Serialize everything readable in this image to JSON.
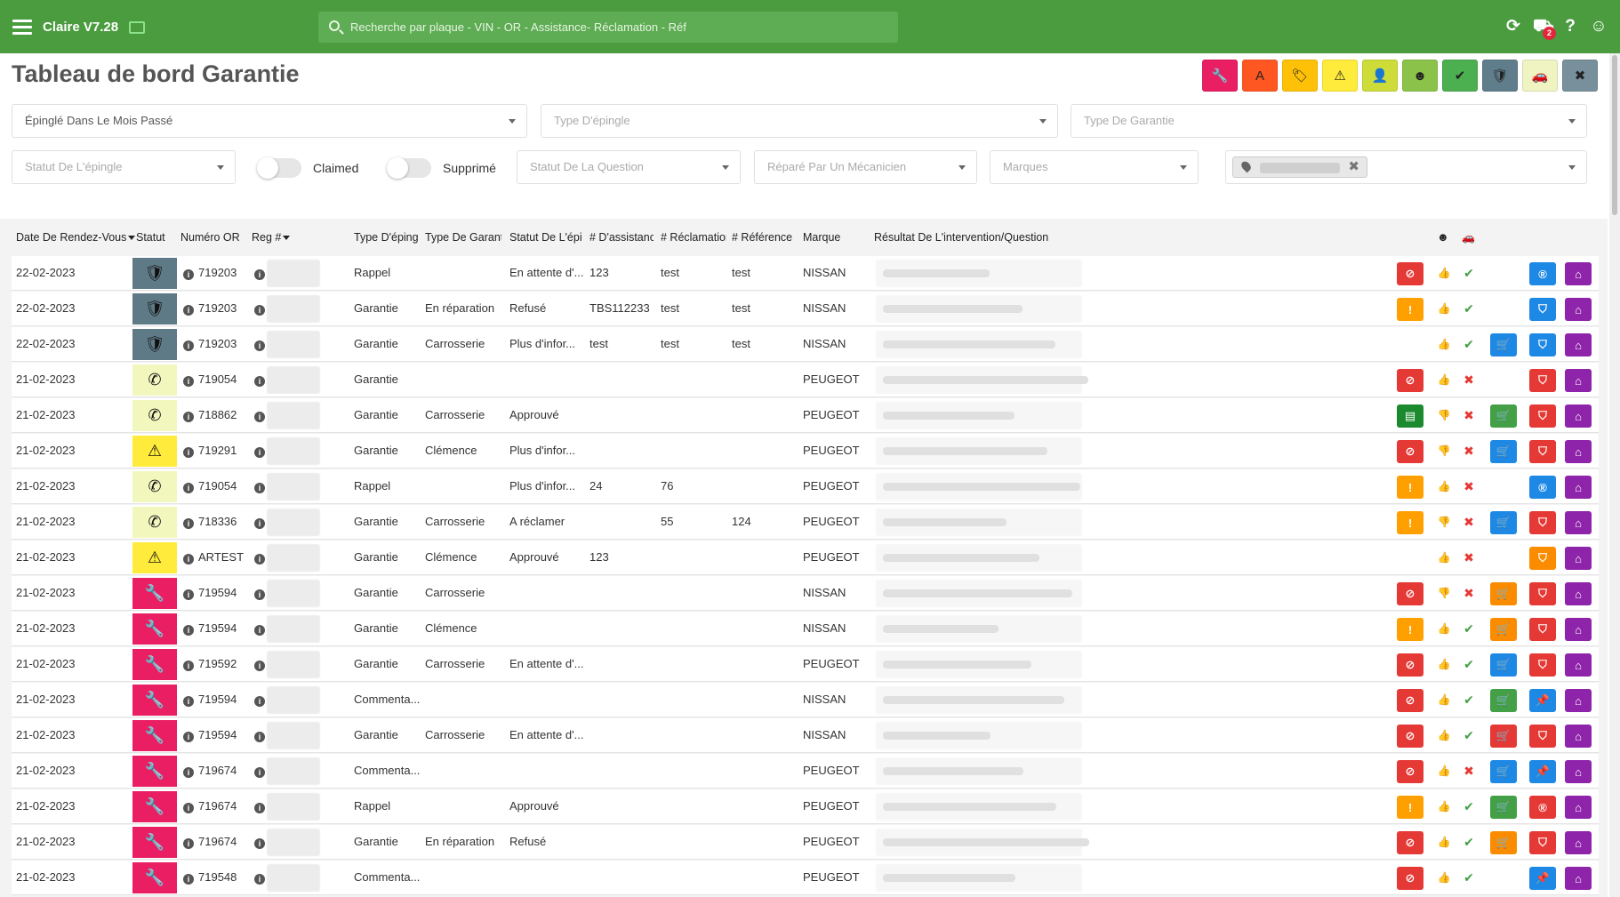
{
  "app": {
    "title": "Claire V7.28"
  },
  "search": {
    "placeholder": "Recherche par plaque - VIN - OR - Assistance- Réclamation - Réf"
  },
  "notifications": {
    "count": "2"
  },
  "page": {
    "title": "Tableau de bord Garantie"
  },
  "filter_buttons": [
    {
      "name": "wrench",
      "color": "#e91e63",
      "glyph": "🔧"
    },
    {
      "name": "letter-a",
      "color": "#ff5722",
      "glyph": "A"
    },
    {
      "name": "tag",
      "color": "#ffc107",
      "glyph": "🏷"
    },
    {
      "name": "warning",
      "color": "#ffeb3b",
      "glyph": "⚠"
    },
    {
      "name": "user-check",
      "color": "#cddc39",
      "glyph": "👤"
    },
    {
      "name": "face",
      "color": "#8bc34a",
      "glyph": "☻"
    },
    {
      "name": "double-check",
      "color": "#4caf50",
      "glyph": "✔"
    },
    {
      "name": "shield",
      "color": "#607d8b",
      "glyph": "🛡"
    },
    {
      "name": "car",
      "color": "#f0f4c3",
      "glyph": "🚗"
    },
    {
      "name": "cancel",
      "color": "#78909c",
      "glyph": "✖"
    }
  ],
  "filters": {
    "pinned": "Épinglé Dans Le Mois Passé",
    "pin_type": "Type D'épingle",
    "warranty_type": "Type De Garantie",
    "pin_status": "Statut De L'épingle",
    "claimed": "Claimed",
    "deleted": "Supprimé",
    "question_status": "Statut De La Question",
    "repaired_by": "Réparé Par Un Mécanicien",
    "brands": "Marques"
  },
  "columns": [
    "Date De Rendez-Vous",
    "Statut",
    "Numéro OR",
    "Reg #",
    "Type D'épingle",
    "Type De Garantie",
    "Statut De L'épingle",
    "# D'assistance",
    "# Réclamation",
    "# Référence",
    "Marque",
    "Résultat De L'intervention/Question"
  ],
  "rows": [
    {
      "date": "22-02-2023",
      "status": "shield",
      "or": "719203",
      "pin_type": "Rappel",
      "warranty": "",
      "pin_status": "En attente d'...",
      "assist": "123",
      "claim": "test",
      "ref": "test",
      "brand": "NISSAN",
      "a1": "ban",
      "thumb": "up",
      "check": "ok",
      "cart": "",
      "b2": "blue-circle",
      "b3": "home"
    },
    {
      "date": "22-02-2023",
      "status": "shield",
      "or": "719203",
      "pin_type": "Garantie",
      "warranty": "En réparation",
      "pin_status": "Refusé",
      "assist": "TBS112233",
      "claim": "test",
      "ref": "test",
      "brand": "NISSAN",
      "a1": "warn",
      "thumb": "up",
      "check": "ok",
      "cart": "",
      "b2": "blue-shield",
      "b3": "home"
    },
    {
      "date": "22-02-2023",
      "status": "shield",
      "or": "719203",
      "pin_type": "Garantie",
      "warranty": "Carrosserie",
      "pin_status": "Plus d'infor...",
      "assist": "test",
      "claim": "test",
      "ref": "test",
      "brand": "NISSAN",
      "a1": "",
      "thumb": "up",
      "check": "ok",
      "cart": "blue",
      "b2": "blue-shield",
      "b3": "home"
    },
    {
      "date": "21-02-2023",
      "status": "phone",
      "or": "719054",
      "pin_type": "Garantie",
      "warranty": "",
      "pin_status": "",
      "assist": "",
      "claim": "",
      "ref": "",
      "brand": "PEUGEOT",
      "a1": "ban",
      "thumb": "up",
      "check": "no",
      "cart": "",
      "b2": "red-shield",
      "b3": "home"
    },
    {
      "date": "21-02-2023",
      "status": "phone",
      "or": "718862",
      "pin_type": "Garantie",
      "warranty": "Carrosserie",
      "pin_status": "Approuvé",
      "assist": "",
      "claim": "",
      "ref": "",
      "brand": "PEUGEOT",
      "a1": "doc",
      "thumb": "down",
      "check": "no",
      "cart": "green",
      "b2": "red-shield",
      "b3": "home"
    },
    {
      "date": "21-02-2023",
      "status": "warning",
      "or": "719291",
      "pin_type": "Garantie",
      "warranty": "Clémence",
      "pin_status": "Plus d'infor...",
      "assist": "",
      "claim": "",
      "ref": "",
      "brand": "PEUGEOT",
      "a1": "ban",
      "thumb": "down",
      "check": "no",
      "cart": "blue",
      "b2": "red-shield",
      "b3": "home"
    },
    {
      "date": "21-02-2023",
      "status": "phone",
      "or": "719054",
      "pin_type": "Rappel",
      "warranty": "",
      "pin_status": "Plus d'infor...",
      "assist": "24",
      "claim": "76",
      "ref": "",
      "brand": "PEUGEOT",
      "a1": "warn",
      "thumb": "up",
      "check": "no",
      "cart": "",
      "b2": "blue-circle",
      "b3": "home"
    },
    {
      "date": "21-02-2023",
      "status": "phone",
      "or": "718336",
      "pin_type": "Garantie",
      "warranty": "Carrosserie",
      "pin_status": "A réclamer",
      "assist": "",
      "claim": "55",
      "ref": "124",
      "brand": "PEUGEOT",
      "a1": "warn",
      "thumb": "down",
      "check": "no",
      "cart": "blue",
      "b2": "red-shield",
      "b3": "home"
    },
    {
      "date": "21-02-2023",
      "status": "warning",
      "or": "ARTEST",
      "pin_type": "Garantie",
      "warranty": "Clémence",
      "pin_status": "Approuvé",
      "assist": "123",
      "claim": "",
      "ref": "",
      "brand": "PEUGEOT",
      "a1": "",
      "thumb": "up",
      "check": "no",
      "cart": "",
      "b2": "orange-shield",
      "b3": "home"
    },
    {
      "date": "21-02-2023",
      "status": "wrench",
      "or": "719594",
      "pin_type": "Garantie",
      "warranty": "Carrosserie",
      "pin_status": "",
      "assist": "",
      "claim": "",
      "ref": "",
      "brand": "NISSAN",
      "a1": "ban",
      "thumb": "down",
      "check": "no",
      "cart": "orange",
      "b2": "red-shield",
      "b3": "home"
    },
    {
      "date": "21-02-2023",
      "status": "wrench",
      "or": "719594",
      "pin_type": "Garantie",
      "warranty": "Clémence",
      "pin_status": "",
      "assist": "",
      "claim": "",
      "ref": "",
      "brand": "NISSAN",
      "a1": "warn",
      "thumb": "up",
      "check": "ok",
      "cart": "orange",
      "b2": "red-shield",
      "b3": "home"
    },
    {
      "date": "21-02-2023",
      "status": "wrench",
      "or": "719592",
      "pin_type": "Garantie",
      "warranty": "Carrosserie",
      "pin_status": "En attente d'...",
      "assist": "",
      "claim": "",
      "ref": "",
      "brand": "PEUGEOT",
      "a1": "ban",
      "thumb": "up",
      "check": "ok",
      "cart": "blue",
      "b2": "red-shield",
      "b3": "home"
    },
    {
      "date": "21-02-2023",
      "status": "wrench",
      "or": "719594",
      "pin_type": "Commenta...",
      "warranty": "",
      "pin_status": "",
      "assist": "",
      "claim": "",
      "ref": "",
      "brand": "NISSAN",
      "a1": "ban",
      "thumb": "up",
      "check": "ok",
      "cart": "green",
      "b2": "blue-pin",
      "b3": "home"
    },
    {
      "date": "21-02-2023",
      "status": "wrench",
      "or": "719594",
      "pin_type": "Garantie",
      "warranty": "Carrosserie",
      "pin_status": "En attente d'...",
      "assist": "",
      "claim": "",
      "ref": "",
      "brand": "NISSAN",
      "a1": "ban",
      "thumb": "up",
      "check": "ok",
      "cart": "red",
      "b2": "red-shield",
      "b3": "home"
    },
    {
      "date": "21-02-2023",
      "status": "wrench",
      "or": "719674",
      "pin_type": "Commenta...",
      "warranty": "",
      "pin_status": "",
      "assist": "",
      "claim": "",
      "ref": "",
      "brand": "PEUGEOT",
      "a1": "ban",
      "thumb": "up",
      "check": "no",
      "cart": "blue",
      "b2": "blue-pin",
      "b3": "home"
    },
    {
      "date": "21-02-2023",
      "status": "wrench",
      "or": "719674",
      "pin_type": "Rappel",
      "warranty": "",
      "pin_status": "Approuvé",
      "assist": "",
      "claim": "",
      "ref": "",
      "brand": "PEUGEOT",
      "a1": "warn",
      "thumb": "up",
      "check": "ok",
      "cart": "green",
      "b2": "red-circle",
      "b3": "home"
    },
    {
      "date": "21-02-2023",
      "status": "wrench",
      "or": "719674",
      "pin_type": "Garantie",
      "warranty": "En réparation",
      "pin_status": "Refusé",
      "assist": "",
      "claim": "",
      "ref": "",
      "brand": "PEUGEOT",
      "a1": "ban",
      "thumb": "up",
      "check": "ok",
      "cart": "orange",
      "b2": "red-shield",
      "b3": "home"
    },
    {
      "date": "21-02-2023",
      "status": "wrench",
      "or": "719548",
      "pin_type": "Commenta...",
      "warranty": "",
      "pin_status": "",
      "assist": "",
      "claim": "",
      "ref": "",
      "brand": "PEUGEOT",
      "a1": "ban",
      "thumb": "up",
      "check": "ok",
      "cart": "",
      "b2": "blue-pin",
      "b3": "home"
    }
  ]
}
